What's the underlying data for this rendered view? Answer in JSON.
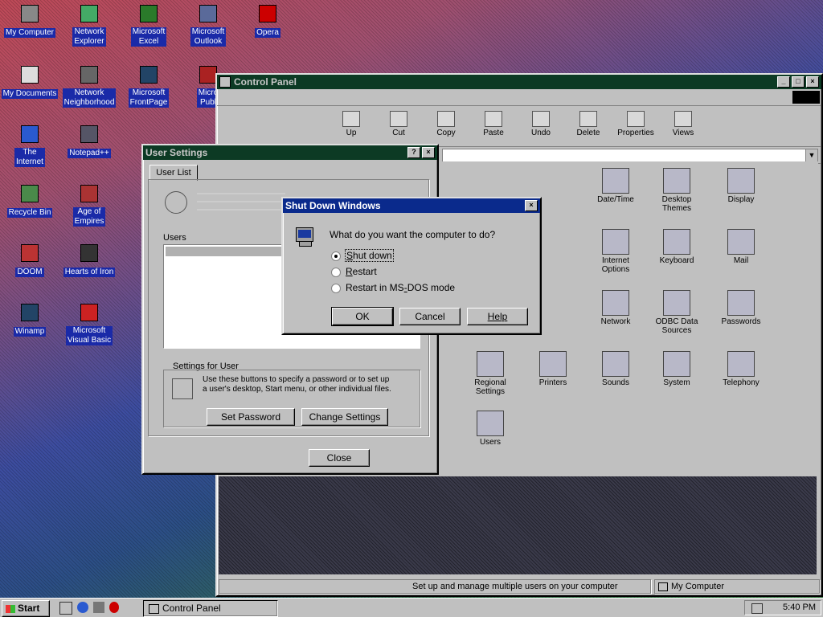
{
  "desktop_icons": [
    {
      "label": "My Computer",
      "glyph": "computer-icon"
    },
    {
      "label": "Network\nExplorer",
      "glyph": "network-icon"
    },
    {
      "label": "Microsoft\nExcel",
      "glyph": "excel-icon"
    },
    {
      "label": "Microsoft\nOutlook",
      "glyph": "outlook-icon"
    },
    {
      "label": "Opera",
      "glyph": "opera-icon"
    },
    {
      "label": "My Documents",
      "glyph": "folder-icon"
    },
    {
      "label": "Network\nNeighborhood",
      "glyph": "network-neighborhood-icon"
    },
    {
      "label": "Microsoft\nFrontPage",
      "glyph": "frontpage-icon"
    },
    {
      "label": "Micro\nPubl",
      "glyph": "publisher-icon"
    },
    {
      "label": "The\nInternet",
      "glyph": "internet-explorer-icon"
    },
    {
      "label": "Notepad++",
      "glyph": "notepad-icon"
    },
    {
      "label": "Recycle Bin",
      "glyph": "recycle-bin-icon"
    },
    {
      "label": "Age of\nEmpires",
      "glyph": "age-of-empires-icon"
    },
    {
      "label": "DOOM",
      "glyph": "doom-icon"
    },
    {
      "label": "Hearts of Iron",
      "glyph": "hearts-of-iron-icon"
    },
    {
      "label": "Winamp",
      "glyph": "winamp-icon"
    },
    {
      "label": "Microsoft\nVisual Basic",
      "glyph": "visual-basic-icon"
    }
  ],
  "control_panel": {
    "title": "Control Panel",
    "toolbar": [
      "Up",
      "Cut",
      "Copy",
      "Paste",
      "Undo",
      "Delete",
      "Properties",
      "Views"
    ],
    "icons": [
      "Date/Time",
      "Desktop\nThemes",
      "Display",
      "Internet\nOptions",
      "Keyboard",
      "Mail",
      "Network",
      "ODBC Data\nSources",
      "Passwords",
      "Printers",
      "Regional\nSettings",
      "Sounds",
      "System",
      "Telephony",
      "Users"
    ],
    "status_text": "Set up and manage multiple users on your computer",
    "status_location": "My Computer"
  },
  "user_settings": {
    "title": "User Settings",
    "tab": "User List",
    "users_label": "Users",
    "settings_for": "Settings for User",
    "settings_desc": "Use these buttons to specify a password or to set up a user's desktop, Start menu, or other individual files.",
    "set_password_btn": "Set Password",
    "change_settings_btn": "Change Settings",
    "close_btn": "Close"
  },
  "shutdown": {
    "title": "Shut Down Windows",
    "question": "What do you want the computer to do?",
    "options": [
      "Shut down",
      "Restart",
      "Restart in MS-DOS mode"
    ],
    "selected": 0,
    "ok": "OK",
    "cancel": "Cancel",
    "help": "Help"
  },
  "taskbar": {
    "start": "Start",
    "task": "Control Panel",
    "clock": "5:40 PM"
  }
}
